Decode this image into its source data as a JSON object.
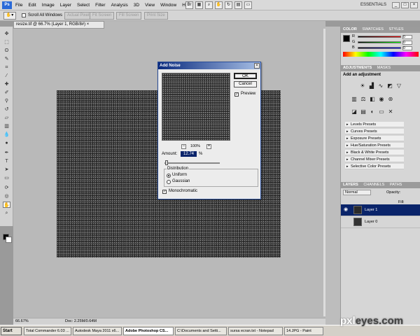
{
  "app": {
    "logo": "Ps",
    "menus": [
      "File",
      "Edit",
      "Image",
      "Layer",
      "Select",
      "Filter",
      "Analysis",
      "3D",
      "View",
      "Window",
      "Help"
    ],
    "menu_icons": [
      "bridge-icon",
      "minibridge-icon",
      "zoom-icon",
      "hand-icon",
      "rotate-icon",
      "arrange-icon",
      "screen-mode-icon"
    ],
    "workspace": "ESSENTIALS",
    "window_buttons": [
      "_",
      "□",
      "×"
    ]
  },
  "options_bar": {
    "scroll_all_windows": "Scroll All Windows",
    "buttons": [
      "Actual Pixels",
      "Fit Screen",
      "Fill Screen",
      "Print Size"
    ]
  },
  "document": {
    "tab_title": "resize.tif @ 66.7% (Layer 1, RGB/8#) ×",
    "zoom": "66.67%",
    "doc_info": "Doc: 2.25M/0.64M"
  },
  "dialog": {
    "title": "Add Noise",
    "ok": "OK",
    "cancel": "Cancel",
    "preview_label": "Preview",
    "preview_checked": true,
    "zoom_level": "100%",
    "amount_label": "Amount:",
    "amount_value": "12.74",
    "amount_unit": "%",
    "slider_level_percent": 4,
    "distribution_label": "Distribution",
    "uniform_label": "Uniform",
    "gaussian_label": "Gaussian",
    "selected_distribution": "Uniform",
    "monochromatic_label": "Monochromatic",
    "monochromatic_checked": true
  },
  "color_panel": {
    "tabs": [
      "COLOR",
      "SWATCHES",
      "STYLES"
    ],
    "channels": [
      {
        "label": "R",
        "value": "0"
      },
      {
        "label": "G",
        "value": "0"
      },
      {
        "label": "B",
        "value": "0"
      }
    ]
  },
  "adjustments_panel": {
    "tabs": [
      "ADJUSTMENTS",
      "MASKS"
    ],
    "heading": "Add an adjustment",
    "presets": [
      "Levels Presets",
      "Curves Presets",
      "Exposure Presets",
      "Hue/Saturation Presets",
      "Black & White Presets",
      "Channel Mixer Presets",
      "Selective Color Presets"
    ]
  },
  "layers_panel": {
    "tabs": [
      "LAYERS",
      "CHANNELS",
      "PATHS"
    ],
    "blend_mode": "Normal",
    "opacity_label": "Opacity:",
    "fill_label": "Fill:",
    "layers": [
      {
        "name": "Layer 1",
        "selected": true
      },
      {
        "name": "Layer 0",
        "selected": false
      }
    ]
  },
  "taskbar": {
    "start": "Start",
    "tasks": [
      "Total Commander 6.03 ...",
      "Autodesk Maya 2011 x6...",
      "Adobe Photoshop CS...",
      "C:\\Documents and Setti...",
      "sursa ecran.txt - Notepad",
      "14.JPG - Paint"
    ],
    "active_task": "Adobe Photoshop CS..."
  },
  "watermark": {
    "part1": "pxl",
    "part2": "eyes.com"
  },
  "colors": {
    "titlebar": "#0a2a7e",
    "selected_layer": "#0a246a",
    "canvas_bg": "#2a2a2a"
  }
}
